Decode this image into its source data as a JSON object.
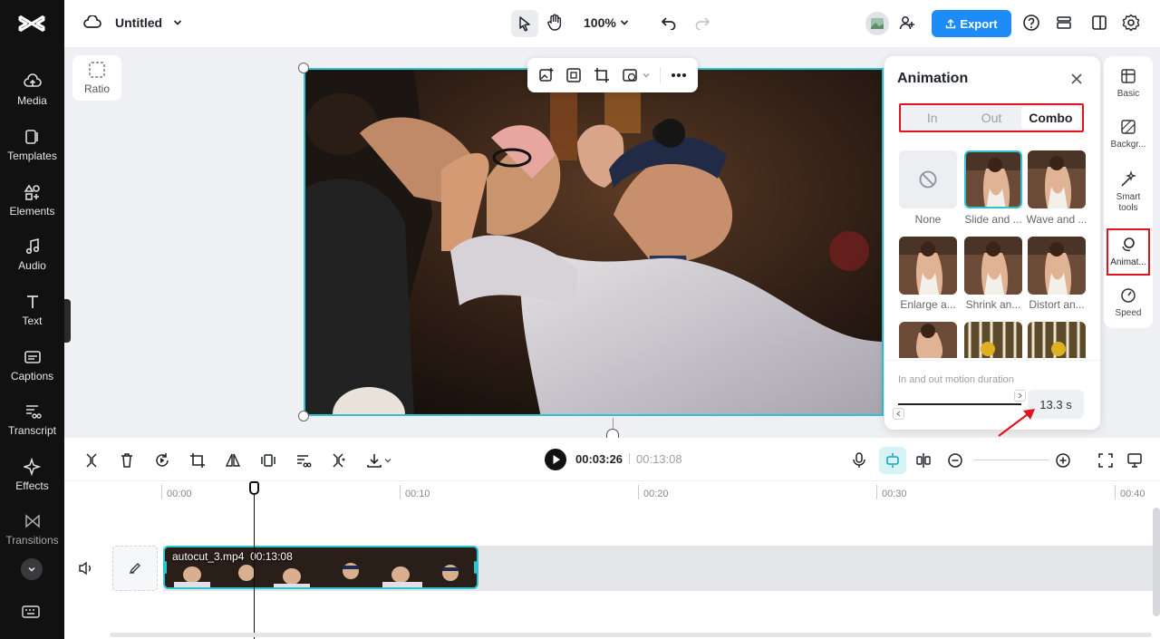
{
  "app": {
    "title": "Untitled",
    "zoom": "100%",
    "export_label": "Export"
  },
  "sidebar": {
    "items": [
      {
        "label": "Media",
        "icon": "cloud-upload-icon"
      },
      {
        "label": "Templates",
        "icon": "templates-icon"
      },
      {
        "label": "Elements",
        "icon": "elements-icon"
      },
      {
        "label": "Audio",
        "icon": "music-note-icon"
      },
      {
        "label": "Text",
        "icon": "text-icon"
      },
      {
        "label": "Captions",
        "icon": "captions-icon"
      },
      {
        "label": "Transcript",
        "icon": "transcript-icon"
      },
      {
        "label": "Effects",
        "icon": "sparkle-icon"
      },
      {
        "label": "Transitions",
        "icon": "bowtie-icon"
      }
    ]
  },
  "canvas": {
    "ratio_label": "Ratio"
  },
  "animation_panel": {
    "title": "Animation",
    "tabs": [
      {
        "label": "In",
        "active": false
      },
      {
        "label": "Out",
        "active": false
      },
      {
        "label": "Combo",
        "active": true
      }
    ],
    "presets": [
      {
        "label": "None",
        "kind": "none"
      },
      {
        "label": "Slide and ...",
        "kind": "image",
        "selected": true
      },
      {
        "label": "Wave and ...",
        "kind": "image"
      },
      {
        "label": "Enlarge a...",
        "kind": "image"
      },
      {
        "label": "Shrink an...",
        "kind": "image"
      },
      {
        "label": "Distort an...",
        "kind": "image"
      }
    ],
    "duration_label": "In and out motion duration",
    "duration_value": "13.3 s",
    "duration_fraction": 1.0
  },
  "right_panel": {
    "items": [
      {
        "label": "Basic"
      },
      {
        "label": "Backgr..."
      },
      {
        "label": "Smart tools"
      },
      {
        "label": "Animat...",
        "active": true
      },
      {
        "label": "Speed"
      }
    ]
  },
  "timeline": {
    "current_time": "00:03:26",
    "total_time": "00:13:08",
    "ruler": [
      "00:00",
      "00:10",
      "00:20",
      "00:30",
      "00:40"
    ],
    "clip": {
      "name": "autocut_3.mp4",
      "duration": "00:13:08"
    }
  },
  "colors": {
    "accent": "#1d8cf8",
    "selection": "#2ec4cf",
    "highlight": "#e0141e"
  }
}
